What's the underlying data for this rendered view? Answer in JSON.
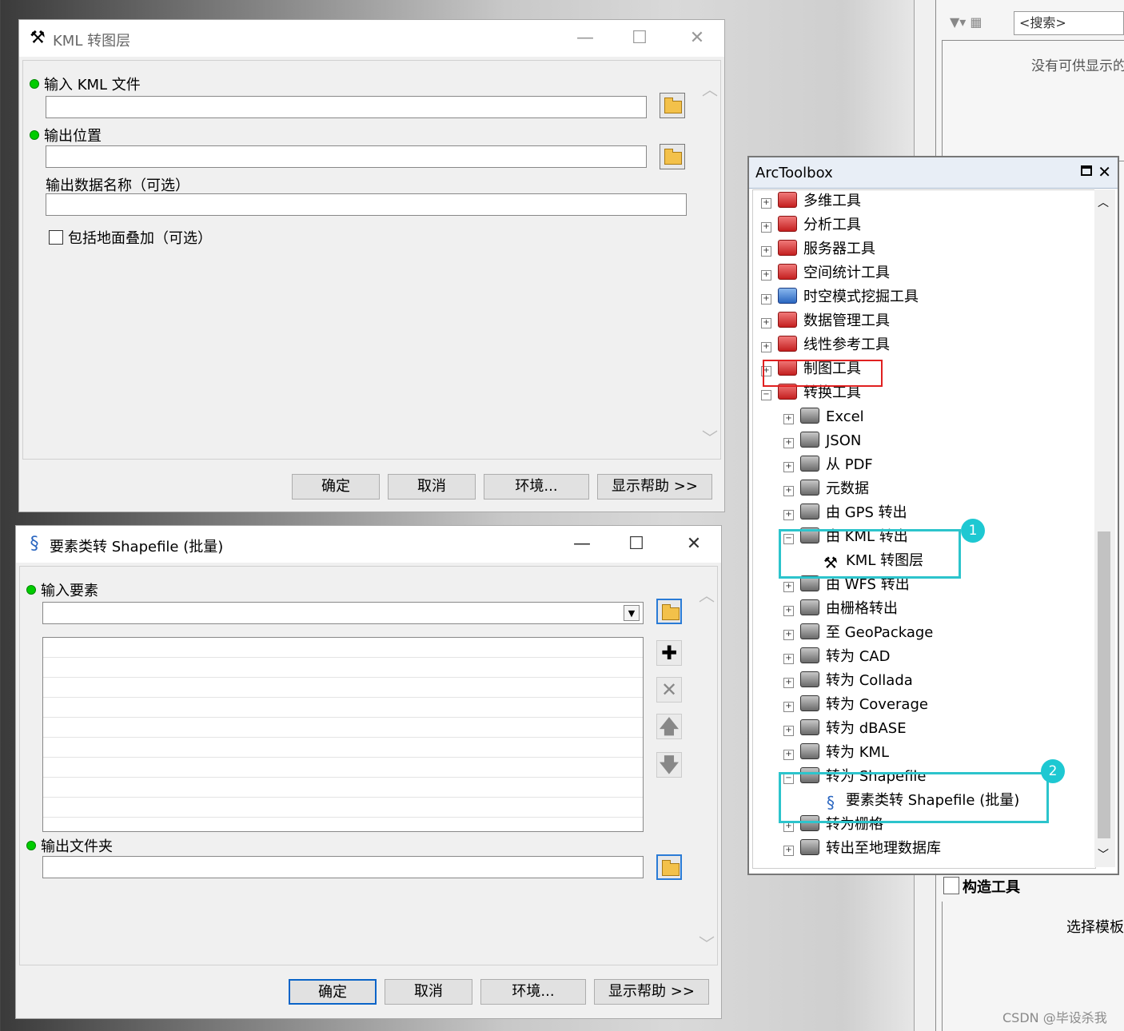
{
  "background": {
    "search_placeholder": "<搜索>",
    "no_items_text": "没有可供显示的",
    "construct_tools": "构造工具",
    "select_template": "选择模板",
    "watermark": "CSDN @毕设杀我"
  },
  "kml_dialog": {
    "title": "KML 转图层",
    "input_kml_label": "输入 KML 文件",
    "output_location_label": "输出位置",
    "output_name_label": "输出数据名称（可选）",
    "include_ground_overlay_label": "包括地面叠加（可选）",
    "ok": "确定",
    "cancel": "取消",
    "env": "环境...",
    "help": "显示帮助 >>"
  },
  "shp_dialog": {
    "title": "要素类转 Shapefile (批量)",
    "input_features_label": "输入要素",
    "output_folder_label": "输出文件夹",
    "ok": "确定",
    "cancel": "取消",
    "env": "环境...",
    "help": "显示帮助 >>"
  },
  "toolbox": {
    "title": "ArcToolbox",
    "top_items": [
      {
        "label": "多维工具",
        "icon": "red-toolbox-icon"
      },
      {
        "label": "分析工具",
        "icon": "red-toolbox-icon"
      },
      {
        "label": "服务器工具",
        "icon": "red-toolbox-icon"
      },
      {
        "label": "空间统计工具",
        "icon": "red-toolbox-icon"
      },
      {
        "label": "时空模式挖掘工具",
        "icon": "blue-toolbox-icon"
      },
      {
        "label": "数据管理工具",
        "icon": "red-toolbox-icon"
      },
      {
        "label": "线性参考工具",
        "icon": "red-toolbox-icon"
      },
      {
        "label": "制图工具",
        "icon": "red-toolbox-icon"
      },
      {
        "label": "转换工具",
        "icon": "red-toolbox-icon"
      }
    ],
    "conversion_children": [
      "Excel",
      "JSON",
      "从 PDF",
      "元数据",
      "由 GPS 转出",
      "由 KML 转出",
      "KML 转图层",
      "由 WFS 转出",
      "由栅格转出",
      "至 GeoPackage",
      "转为 CAD",
      "转为 Collada",
      "转为 Coverage",
      "转为 dBASE",
      "转为 KML",
      "转为 Shapefile",
      "要素类转 Shapefile (批量)",
      "转为栅格",
      "转出至地理数据库"
    ],
    "badge1": "1",
    "badge2": "2"
  }
}
